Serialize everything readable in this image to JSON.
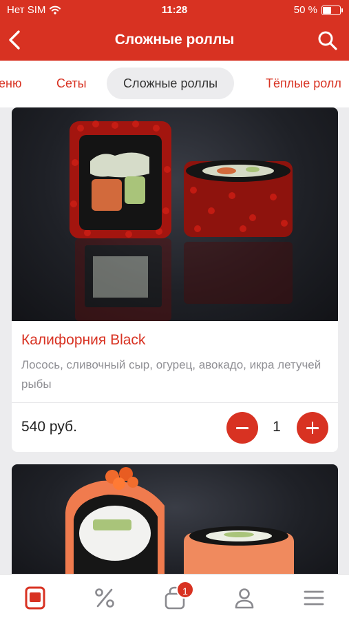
{
  "status_bar": {
    "carrier": "Нет SIM",
    "time": "11:28",
    "battery_percent": "50 %",
    "battery_level": 0.5
  },
  "header": {
    "title": "Сложные роллы",
    "back_icon": "chevron-left-icon",
    "search_icon": "search-icon"
  },
  "tabs": [
    {
      "label": "еню",
      "active": false
    },
    {
      "label": "Сеты",
      "active": false
    },
    {
      "label": "Сложные роллы",
      "active": true
    },
    {
      "label": "Тёплые ролл",
      "active": false
    }
  ],
  "products": [
    {
      "name": "Калифорния Black",
      "description": "Лосось, сливочный сыр, огурец, авокадо, икра летучей рыбы",
      "price": "540 руб.",
      "quantity": "1"
    }
  ],
  "bottom_nav": {
    "items": [
      "menu-card-icon",
      "discount-percent-icon",
      "cart-bag-icon",
      "profile-icon",
      "hamburger-menu-icon"
    ],
    "cart_badge": "1"
  },
  "colors": {
    "accent": "#d83222",
    "background": "#ececee",
    "muted_text": "#8f8f94"
  }
}
